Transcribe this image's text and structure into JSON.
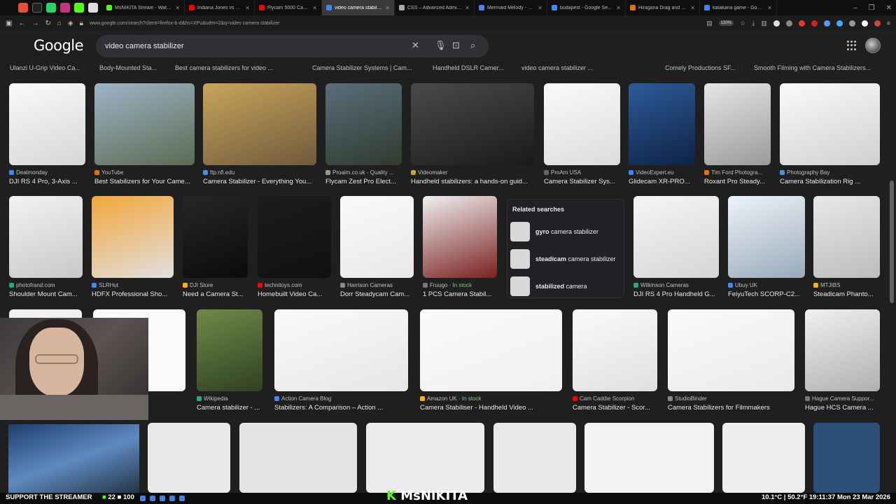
{
  "browser": {
    "tabs": [
      {
        "label": "MsNIKITA Stream - Watch Live",
        "fav": "#53fc18"
      },
      {
        "label": "Indiana Jones vs Nathan Drake",
        "fav": "#ff0000"
      },
      {
        "label": "Flycam 5000 Camera Stabilizer",
        "fav": "#ff0000"
      },
      {
        "label": "video camera stabilizer - Google",
        "fav": "#4285f4"
      },
      {
        "label": "CSS – Advanced Administration",
        "fav": "#aaaaaa"
      },
      {
        "label": "Mermaid Melody - Google Search",
        "fav": "#4285f4"
      },
      {
        "label": "budapest - Google Search",
        "fav": "#4285f4"
      },
      {
        "label": "Hiragana Drag and Drop or Ki",
        "fav": "#e37400"
      },
      {
        "label": "katakana game - Google Search",
        "fav": "#4285f4"
      }
    ],
    "url": "www.google.com/search?client=firefox-b-d&hs=XPu&udm=2&q=video camera stabilizer",
    "zoom": "130%"
  },
  "google": {
    "logo": "Google",
    "query": "video camera stabilizer"
  },
  "chips": [
    "Ulanzi U-Grip Video Ca...",
    "Body-Mounted Sta...",
    "Best camera stabilizers for video ...",
    "Camera Stabilizer Systems | Cam...",
    "Handheld DSLR Camer...",
    "video camera stabilizer ...",
    "Comely Productions SF...",
    "Smooth Filming with Camera Stabilizers..."
  ],
  "row1": [
    {
      "source": "Dealmonday",
      "caption": "DJI RS 4 Pro, 3-Axis ..."
    },
    {
      "source": "YouTube",
      "caption": "Best Stabilizers for Your Came..."
    },
    {
      "source": "ftp.nfi.edu",
      "caption": "Camera Stabilizer - Everything You..."
    },
    {
      "source": "Proaim.co.uk - Quality ...",
      "caption": "Flycam Zest Pro Elect..."
    },
    {
      "source": "Videomaker",
      "caption": "Handheld stabilizers: a hands-on guid..."
    },
    {
      "source": "ProAm USA",
      "caption": "Camera Stabilizer Sys..."
    },
    {
      "source": "VideoExpert.eu",
      "caption": "Glidecam XR-PRO..."
    },
    {
      "source": "Tim Ford Photogra...",
      "caption": "Roxant Pro Steady..."
    },
    {
      "source": "Photography Bay",
      "caption": "Camera Stabilization Rig ..."
    }
  ],
  "row2": [
    {
      "source": "photofrand.com",
      "caption": "Shoulder Mount Cam..."
    },
    {
      "source": "SLRHut",
      "caption": "HDFX Professional Sho..."
    },
    {
      "source": "DJI Store",
      "caption": "Need a Camera St..."
    },
    {
      "source": "technitoys.com",
      "caption": "Homebuilt Video Ca..."
    },
    {
      "source": "Harrison Cameras",
      "caption": "Dorr Steadycam Cam..."
    },
    {
      "source": "Fruugo",
      "stock": "In stock",
      "caption": "1 PCS Camera Stabil..."
    },
    {
      "source": "Wilkinson Cameras",
      "caption": "DJI RS 4 Pro Handheld G..."
    },
    {
      "source": "Ubuy UK",
      "caption": "FeiyuTech SCORP-C2..."
    },
    {
      "source": "MTJIBS",
      "caption": "Steadicam Phanto..."
    }
  ],
  "row3": [
    {
      "source": "Wikipedia",
      "caption": "Camera stabilizer - ..."
    },
    {
      "source": "Action Camera Blog",
      "caption": "Stabilizers: A Comparison – Action ..."
    },
    {
      "source": "Amazon UK",
      "stock": "In stock",
      "caption": "Camera Stabiliser - Handheld Video ..."
    },
    {
      "source": "Cam Caddie Scorpion",
      "caption": "Camera Stabilizer - Scor..."
    },
    {
      "source": "StudioBinder",
      "caption": "Camera Stabilizers for Filmmakers"
    },
    {
      "source": "Hague Camera Suppor...",
      "caption": "Hague HCS Camera ..."
    }
  ],
  "related": {
    "title": "Related searches",
    "items": [
      {
        "bold": "gyro",
        "rest": " camera stabilizer"
      },
      {
        "bold": "steadicam",
        "rest": " camera stabilizer"
      },
      {
        "bold": "stabilized",
        "rest": " camera"
      }
    ]
  },
  "stream": {
    "support": "SUPPORT THE STREAMER",
    "count1": "22",
    "count2": "100",
    "handle_k": "K",
    "handle": "MsNIKITA",
    "clock": "10.1°C | 50.2°F   19:11:37   Mon 23 Mar 2026"
  }
}
